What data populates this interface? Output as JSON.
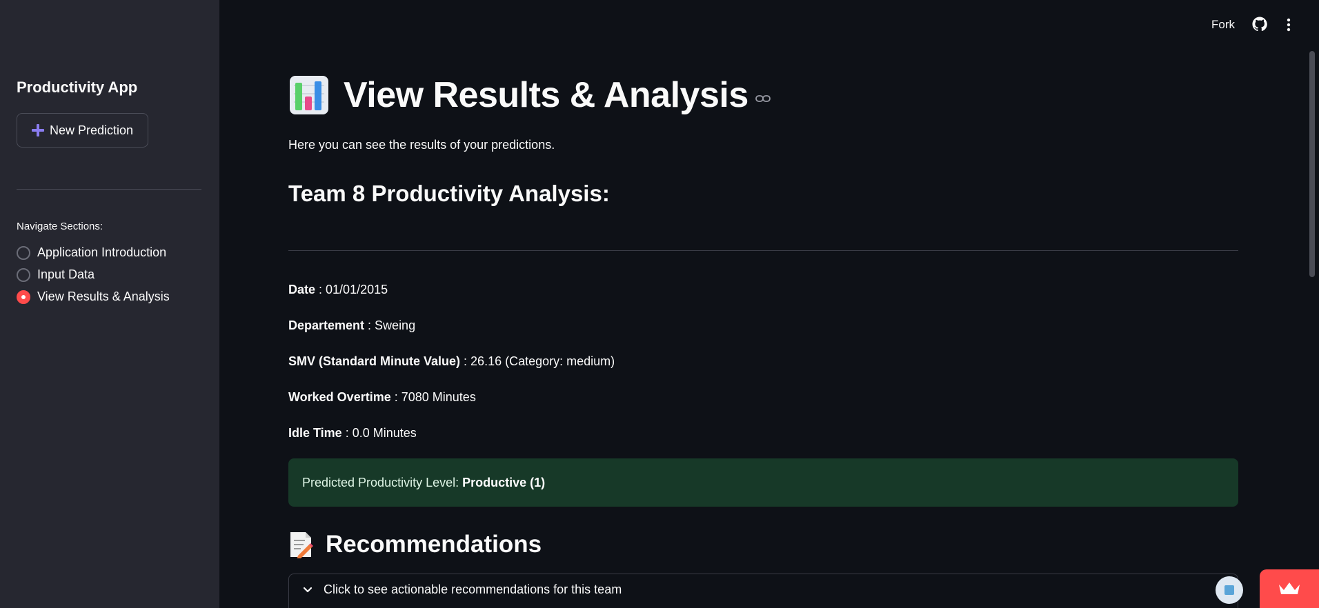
{
  "sidebar": {
    "title": "Productivity App",
    "new_button_label": "New Prediction",
    "nav_label": "Navigate Sections:",
    "nav_items": [
      {
        "label": "Application Introduction",
        "selected": false
      },
      {
        "label": "Input Data",
        "selected": false
      },
      {
        "label": "View Results & Analysis",
        "selected": true
      }
    ]
  },
  "header": {
    "fork_label": "Fork",
    "github_icon": "github-icon",
    "menu_icon": "kebab-menu-icon"
  },
  "main": {
    "title": "View Results & Analysis",
    "subtitle": "Here you can see the results of your predictions.",
    "section_title": "Team 8 Productivity Analysis:",
    "details": [
      {
        "label": "Date",
        "sep": " : ",
        "value": "01/01/2015"
      },
      {
        "label": "Departement",
        "sep": " : ",
        "value": "Sweing"
      },
      {
        "label": "SMV (Standard Minute Value)",
        "sep": " : ",
        "value": "26.16 (Category: medium)"
      },
      {
        "label": "Worked Overtime",
        "sep": " : ",
        "value": "7080 Minutes"
      },
      {
        "label": "Idle Time",
        "sep": " : ",
        "value": "0.0 Minutes"
      }
    ],
    "prediction_prefix": "Predicted Productivity Level:",
    "prediction_value": "Productive (1)",
    "recommendations_title": "Recommendations",
    "expander_label": "Click to see actionable recommendations for this team"
  },
  "colors": {
    "accent": "#ff4b4b",
    "success_bg": "#173928",
    "sidebar_bg": "#262730",
    "main_bg": "#0e1117"
  }
}
